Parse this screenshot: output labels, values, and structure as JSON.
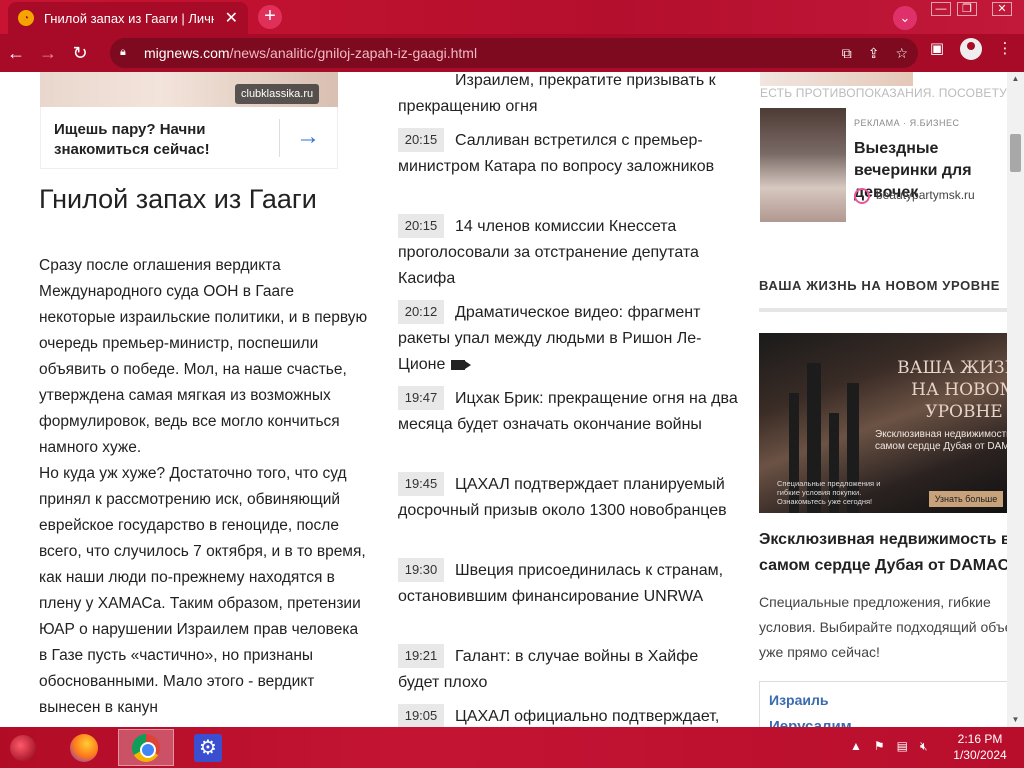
{
  "browser": {
    "tab_title": "Гнилой запах из Гааги | Личный",
    "tab_close": "✕",
    "new_tab": "+",
    "url_domain": "mignews.com",
    "url_path": "/news/analitic/gniloj-zapah-iz-gaagi.html",
    "win_min": "—",
    "win_max": "❐",
    "win_close": "✕"
  },
  "ad_left": {
    "badge": "clubklassika.ru",
    "text": "Ищешь пару? Начни знакомиться сейчас!",
    "arrow": "→"
  },
  "article": {
    "title": "Гнилой запах из Гааги",
    "paragraphs": [
      "Сразу после оглашения вердикта Международного суда ООН в Гааге некоторые израильские политики, и в первую очередь премьер-министр, поспешили объявить о победе. Мол, на наше счастье, утверждена самая мягкая из возможных формулировок, ведь все могло кончиться намного хуже.",
      "Но куда уж хуже? Достаточно того, что суд принял к рассмотрению иск, обвиняющий еврейское государство в геноциде, после всего, что случилось 7 октября, и в то время, как наши люди по-прежнему находятся в плену у ХАМАСа. Таким образом, претензии ЮАР о нарушении Израилем прав человека в Газе пусть «частично», но признаны обоснованными. Мало этого - вердикт вынесен в канун"
    ]
  },
  "news_first_tail": "Израилем, прекратите призывать к прекращению огня",
  "news": [
    {
      "time": "20:15",
      "text": "Салливан встретился с премьер-министром Катара по вопросу заложников"
    },
    {
      "time": "20:15",
      "text": "14 членов комиссии Кнессета проголосовали за отстранение депутата Касифа"
    },
    {
      "time": "20:12",
      "text": "Драматическое видео: фрагмент ракеты упал между людьми в Ришон Ле-Ционе"
    },
    {
      "time": "19:47",
      "text": "Ицхак Брик: прекращение огня на два месяца будет означать окончание войны"
    },
    {
      "time": "19:45",
      "text": "ЦАХАЛ подтверждает планируемый досрочный призыв около 1300 новобранцев"
    },
    {
      "time": "19:30",
      "text": "Швеция присоединилась к странам, остановившим финансирование UNRWA"
    },
    {
      "time": "19:21",
      "text": "Галант: в случае войны в Хайфе будет плохо"
    },
    {
      "time": "19:05",
      "text": "ЦАХАЛ официально подтверждает,"
    }
  ],
  "right": {
    "disclaimer": "ЕСТЬ ПРОТИВОПОКАЗАНИЯ. ПОСОВЕТУЙТЕСЬ С ВРАЧОМ",
    "ad_label": "РЕКЛАМА · Я.БИЗНЕС",
    "ad_title": "Выездные вечеринки для девочек",
    "ad_domain": "beautypartymsk.ru",
    "section_title": "ВАША ЖИЗНЬ НА НОВОМ УРОВНЕ",
    "banner_head": "ВАША ЖИЗНЬ НА НОВОМ УРОВНЕ",
    "banner_sub": "Эксклюзивная недвижимость в самом сердце Дубая от DAMAC",
    "banner_small": "Специальные предложения и гибкие условия покупки. Ознакомьтесь уже сегодня!",
    "banner_btn": "Узнать больше",
    "promo_title_1": "Эксклюзивная недвижимость в",
    "promo_title_2": "самом сердце Дубая от DAMAC",
    "promo_desc_1": "Специальные предложения, гибкие",
    "promo_desc_2": "условия. Выбирайте подходящий объект",
    "promo_desc_3": "уже прямо сейчас!",
    "widget_line1": "Израиль",
    "widget_line2": "Иерусалим"
  },
  "taskbar": {
    "time": "2:16 PM",
    "date": "1/30/2024"
  },
  "colors": {
    "theme_red": "#b40f2d",
    "time_badge_bg": "#e8e8e8",
    "link_blue": "#2b6fd6"
  }
}
